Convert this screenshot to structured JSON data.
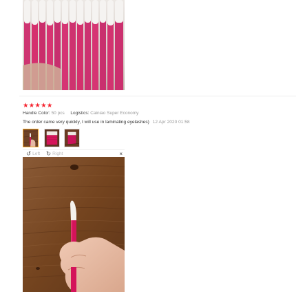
{
  "review": {
    "rating": 5,
    "stars": "★★★★★",
    "handle_color_label": "Handle Color:",
    "handle_color_value": "50 pcs",
    "logistics_label": "Logistics:",
    "logistics_value": "Cainiao Super Economy",
    "feedback_text": "The order came very quickly, I will use in laminating eyelashes)",
    "date": "12 Apr 2020 01:58",
    "thumbnails": 3,
    "selected_thumbnail": 1
  },
  "viewer": {
    "rotate_left_label": "Left",
    "rotate_right_label": "Right",
    "close_symbol": "×",
    "rotate_left_icon": "rotate-left-icon",
    "rotate_right_icon": "rotate-right-icon",
    "close_icon": "close-icon"
  },
  "colors": {
    "star": "#f5222d",
    "wand_pink": "#d4145a",
    "selected_border": "#f5a623",
    "wood": "#7a4a28"
  }
}
